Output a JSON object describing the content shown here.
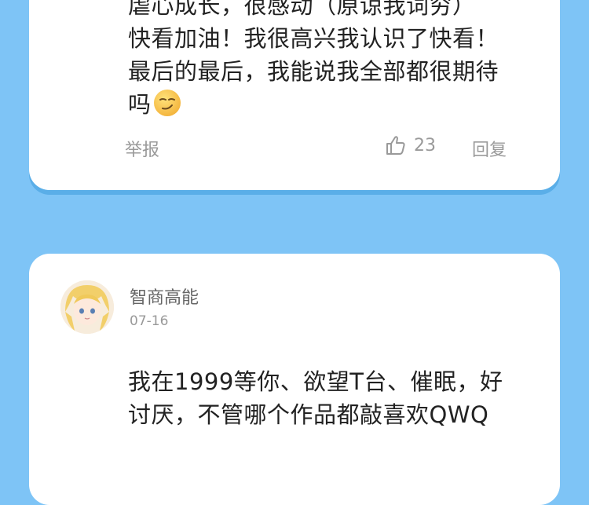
{
  "comment1": {
    "lines": [
      "虐心成长，很感动（原谅我词穷）",
      "快看加油！我很高兴我认识了快看！",
      "最后的最后，我能说我全部都很期待",
      "吗"
    ],
    "emoji": "smirk-emoji",
    "report_label": "举报",
    "like_count": "23",
    "reply_label": "回复"
  },
  "comment2": {
    "username": "智商高能",
    "date": "07-16",
    "lines": [
      "我在1999等你、欲望T台、催眠，好",
      "讨厌，不管哪个作品都敲喜欢QWQ"
    ]
  }
}
